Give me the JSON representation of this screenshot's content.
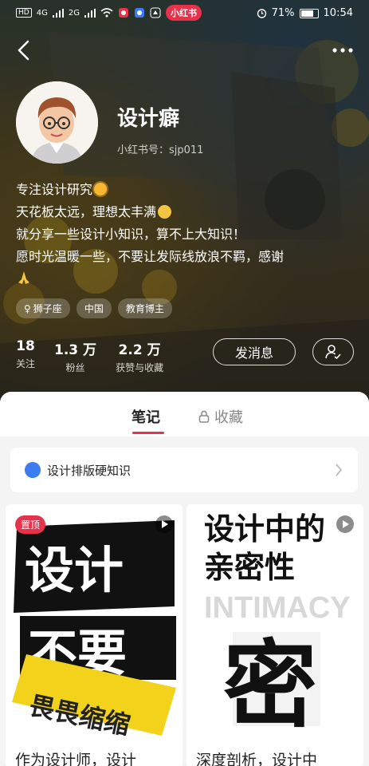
{
  "status_bar": {
    "network": "HD",
    "signal1": "4G",
    "signal2": "2G",
    "app_badge": "小红书",
    "battery": "71%",
    "time": "10:54"
  },
  "profile": {
    "name": "设计癖",
    "id_label": "小红书号：sjp011",
    "bio": [
      "专注设计研究",
      "天花板太远，理想太丰满",
      "就分享一些设计小知识，算不上大知识！",
      "愿时光温暖一些，不要让发际线放浪不羁，感谢"
    ],
    "tags": [
      "狮子座",
      "中国",
      "教育博主"
    ],
    "stats": [
      {
        "num": "18",
        "label": "关注"
      },
      {
        "num": "1.3 万",
        "label": "粉丝"
      },
      {
        "num": "2.2 万",
        "label": "获赞与收藏"
      }
    ],
    "message_button": "发消息"
  },
  "tabs": {
    "notes": "笔记",
    "favorites": "收藏"
  },
  "collection": {
    "label": "设计排版硬知识"
  },
  "cards": [
    {
      "pin": "置顶",
      "art_lines": [
        "设计",
        "不要",
        "畏畏缩缩"
      ],
      "title": "作为设计师，设计"
    },
    {
      "art_lines": [
        "设计中的",
        "亲密性",
        "INTIMACY",
        "密"
      ],
      "title": "深度剖析，设计中"
    }
  ],
  "colors": {
    "accent": "#e8314a",
    "card_yellow": "#f2d21b",
    "text_dark": "#222222"
  }
}
